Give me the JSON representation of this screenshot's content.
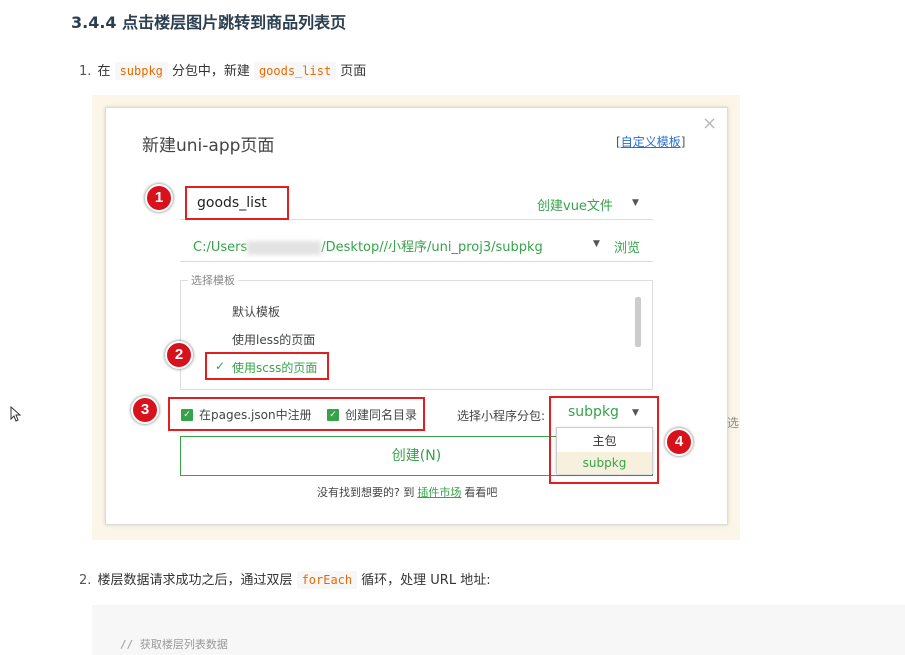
{
  "heading": "3.4.4 点击楼层图片跳转到商品列表页",
  "step1": {
    "num": "1.",
    "pre": "在",
    "code1": "subpkg",
    "mid": "分包中，新建",
    "code2": "goods_list",
    "post": "页面"
  },
  "dialog": {
    "title": "新建uni-app页面",
    "custom_template": "自定义模板",
    "close": "×",
    "name_value": "goods_list",
    "create_vue": "创建vue文件",
    "path_prefix": "C:/Users",
    "path_suffix": "/Desktop//小程序/uni_proj3/subpkg",
    "browse": "浏览",
    "template_legend": "选择模板",
    "templates": [
      "默认模板",
      "使用less的页面",
      "使用scss的页面"
    ],
    "selected_template_index": 2,
    "checkbox_pages_json": "在pages.json中注册",
    "checkbox_same_dir": "创建同名目录",
    "subpackage_label": "选择小程序分包:",
    "subpackage_value": "subpkg",
    "dropdown_options": [
      "主包",
      "subpkg"
    ],
    "create_button": "创建(N)",
    "footer_pre": "没有找到想要的? 到",
    "footer_link": "插件市场",
    "footer_post": "看看吧",
    "clipped_right": "选"
  },
  "badges": [
    "1",
    "2",
    "3",
    "4"
  ],
  "step2": {
    "num": "2.",
    "pre": "楼层数据请求成功之后，通过双层",
    "code": "forEach",
    "post": "循环，处理 URL 地址:"
  },
  "code_comment": "//  获取楼层列表数据",
  "colors": {
    "green": "#36a34a",
    "red": "#e02020",
    "badge": "#d8121c",
    "inline_code": "#e96900",
    "link": "#2a6fc9"
  },
  "icons": {
    "cursor": "mouse-cursor-icon",
    "check": "checkmark-icon",
    "caret": "caret-down-icon"
  }
}
